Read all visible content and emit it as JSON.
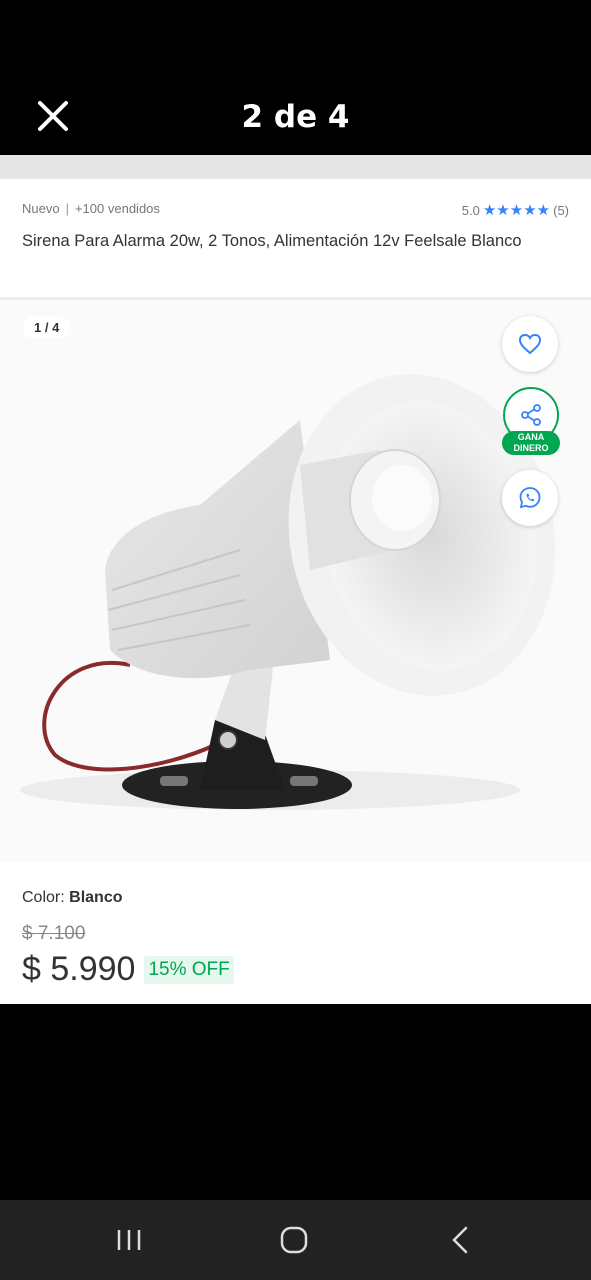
{
  "viewer": {
    "close_icon": "close-icon",
    "counter": "2 de 4"
  },
  "product": {
    "condition": "Nuevo",
    "separator": "|",
    "sold": "+100 vendidos",
    "rating_value": "5.0",
    "stars": "★★★★★",
    "rating_score": 5,
    "review_count": "(5)",
    "title": "Sirena Para Alarma 20w, 2 Tonos, Alimentación 12v Feelsale Blanco",
    "image_counter": "1 / 4",
    "color_label": "Color:",
    "color_value": "Blanco",
    "old_price": "$ 7.100",
    "price": "$ 5.990",
    "discount": "15% OFF"
  },
  "actions": {
    "favorite_icon": "heart-icon",
    "share_icon": "share-icon",
    "share_badge_line1": "GANA",
    "share_badge_line2": "DINERO",
    "whatsapp_icon": "whatsapp-icon"
  },
  "navigation": {
    "recents_icon": "recents-icon",
    "home_icon": "home-icon",
    "back_icon": "back-icon"
  },
  "colors": {
    "accent_blue": "#3483fa",
    "accent_green": "#00a650",
    "discount_bg": "#e6f7ed"
  }
}
